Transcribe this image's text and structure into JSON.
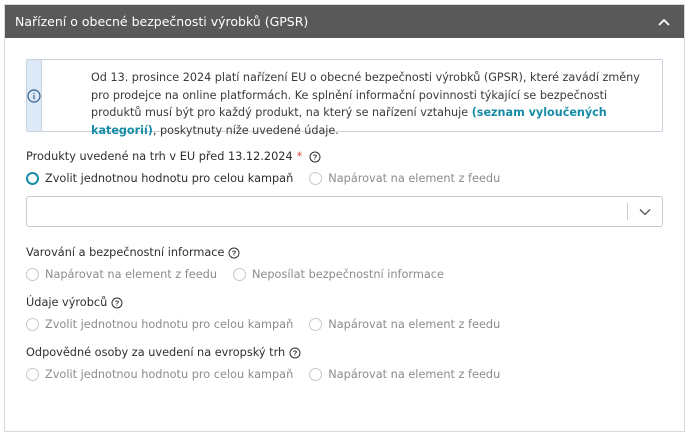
{
  "panel": {
    "title": "Nařízení o obecné bezpečnosti výrobků (GPSR)"
  },
  "info": {
    "text_before": "Od 13. prosince 2024 platí nařízení EU o obecné bezpečnosti výrobků (GPSR), které zavádí změny pro prodejce na online platformách. Ke splnění informační povinnosti týkající se bezpečnosti produktů musí být pro každý produkt, na který se nařízení vztahuje ",
    "link": "(seznam vyloučených kategorií)",
    "text_after": ", poskytnuty níže uvedené údaje."
  },
  "sections": {
    "products": {
      "label": "Produkty uvedené na trh v EU před 13.12.2024",
      "required_mark": "*",
      "option_a": "Zvolit jednotnou hodnotu pro celou kampaň",
      "option_b": "Napárovat na element z feedu",
      "selected": "option_a",
      "select_value": ""
    },
    "warnings": {
      "label": "Varování a bezpečnostní informace",
      "option_a": "Napárovat na element z feedu",
      "option_b": "Neposílat bezpečnostní informace"
    },
    "manufacturer": {
      "label": "Údaje výrobců",
      "option_a": "Zvolit jednotnou hodnotu pro celou kampaň",
      "option_b": "Napárovat na element z feedu"
    },
    "responsible": {
      "label": "Odpovědné osoby za uvedení na evropský trh",
      "option_a": "Zvolit jednotnou hodnotu pro celou kampaň",
      "option_b": "Napárovat na element z feedu"
    }
  },
  "colors": {
    "header_bg": "#595959",
    "accent": "#178ca6",
    "info_bg": "#dde9f7",
    "required": "#d9453a"
  },
  "icons": {
    "collapse": "chevron-up-icon",
    "info": "info-circle-icon",
    "help": "question-circle-icon",
    "select": "chevron-down-icon"
  }
}
